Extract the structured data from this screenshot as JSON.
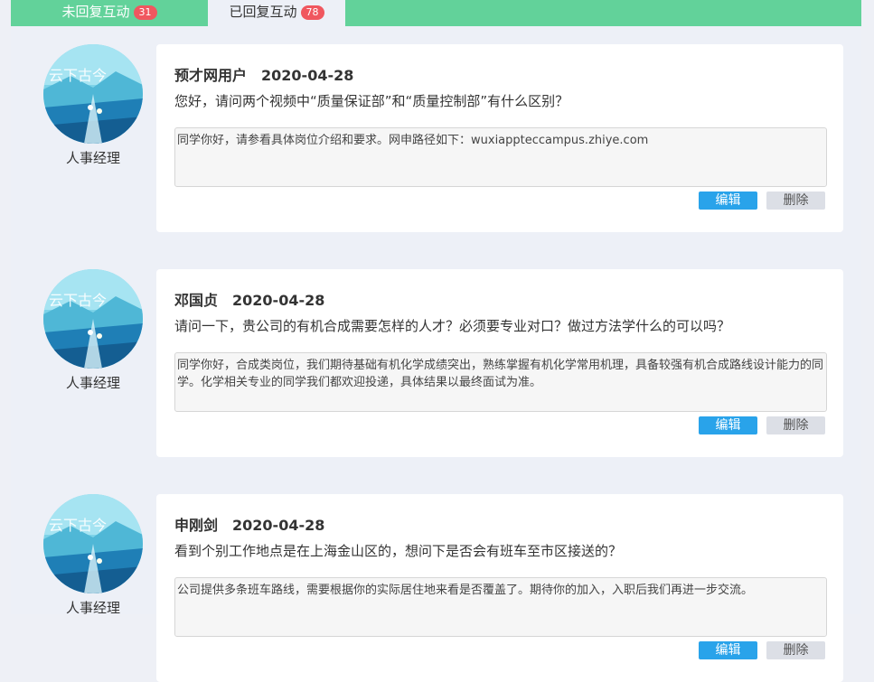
{
  "tabs": [
    {
      "label": "未回复互动",
      "count": "31"
    },
    {
      "label": "已回复互动",
      "count": "78"
    }
  ],
  "items": [
    {
      "role": "人事经理",
      "user": "预才网用户",
      "date": "2020-04-28",
      "question": "您好，请问两个视频中“质量保证部”和“质量控制部”有什么区别？",
      "answer": "同学你好，请参看具体岗位介绍和要求。网申路径如下：wuxiappteccampus.zhiye.com",
      "edit": "编辑",
      "delete": "删除"
    },
    {
      "role": "人事经理",
      "user": "邓国贞",
      "date": "2020-04-28",
      "question": "请问一下，贵公司的有机合成需要怎样的人才？必须要专业对口？做过方法学什么的可以吗？",
      "answer": "同学你好，合成类岗位，我们期待基础有机化学成绩突出，熟练掌握有机化学常用机理，具备较强有机合成路线设计能力的同学。化学相关专业的同学我们都欢迎投递，具体结果以最终面试为准。",
      "edit": "编辑",
      "delete": "删除"
    },
    {
      "role": "人事经理",
      "user": "申刚剑",
      "date": "2020-04-28",
      "question": "看到个别工作地点是在上海金山区的，想问下是否会有班车至市区接送的？",
      "answer": "公司提供多条班车路线，需要根据你的实际居住地来看是否覆盖了。期待你的加入，入职后我们再进一步交流。",
      "edit": "编辑",
      "delete": "删除"
    }
  ]
}
